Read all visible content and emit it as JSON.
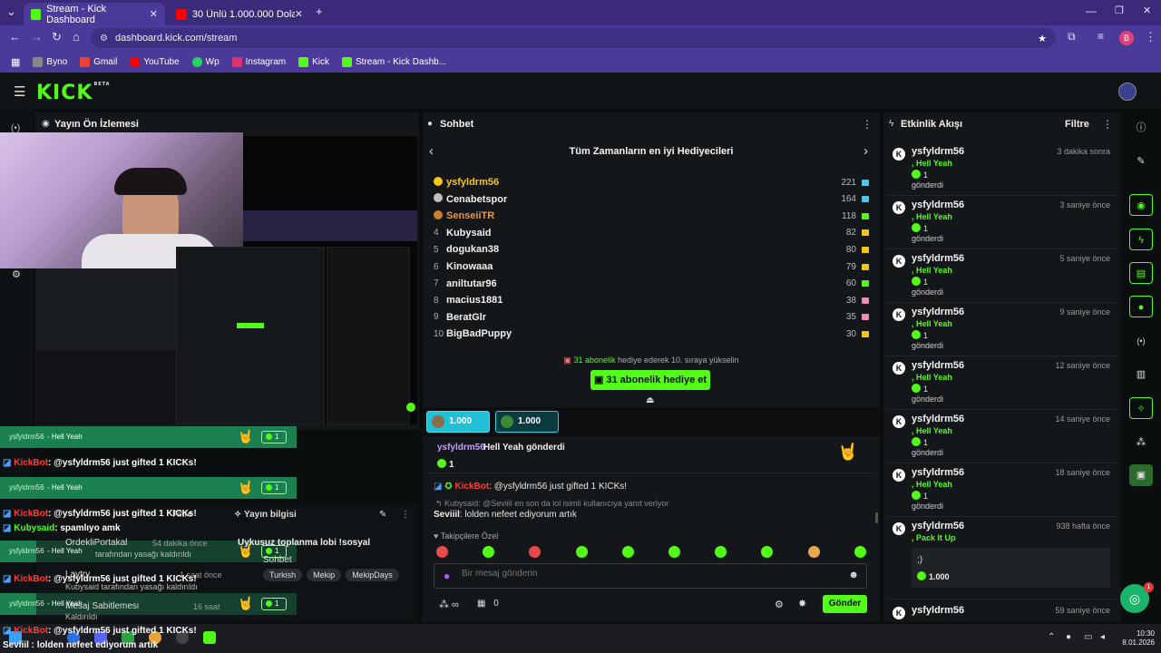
{
  "browser": {
    "tabs": [
      {
        "label": "Stream - Kick Dashboard",
        "active": true,
        "fav_color": "#53fc18"
      },
      {
        "label": "30 Ünlü 1.000.000 Dolar için Ya...",
        "active": false,
        "fav_color": "#ff0000"
      }
    ],
    "new_tab": "+",
    "url": "dashboard.kick.com/stream",
    "profile_initial": "B",
    "bookmarks": [
      {
        "label": "Byno",
        "color": "#888"
      },
      {
        "label": "Gmail",
        "color": "#ea4335"
      },
      {
        "label": "YouTube",
        "color": "#ff0000"
      },
      {
        "label": "Wp",
        "color": "#25d366"
      },
      {
        "label": "Instagram",
        "color": "#e1306c"
      },
      {
        "label": "Kick",
        "color": "#53fc18"
      },
      {
        "label": "Stream - Kick Dashb...",
        "color": "#53fc18"
      }
    ]
  },
  "app": {
    "logo": "KICK",
    "beta": "BETA"
  },
  "preview": {
    "title": "Yayın Ön İzlemesi"
  },
  "chat": {
    "title": "Sohbet",
    "leaderboard_title": "Tüm Zamanların en iyi Hediyecileri",
    "leaders": [
      {
        "rank": "1",
        "name": "ysfyldrm56",
        "count": "221",
        "color": "#f5c518"
      },
      {
        "rank": "2",
        "name": "Cenabetspor",
        "count": "164",
        "color": "#c0c0c0"
      },
      {
        "rank": "3",
        "name": "SenseiiTR",
        "count": "118",
        "color": "#cd7f32"
      },
      {
        "rank": "4",
        "name": "Kubysaid",
        "count": "82",
        "color": ""
      },
      {
        "rank": "5",
        "name": "dogukan38",
        "count": "80",
        "color": ""
      },
      {
        "rank": "6",
        "name": "Kinowaaa",
        "count": "79",
        "color": ""
      },
      {
        "rank": "7",
        "name": "aniltutar96",
        "count": "60",
        "color": ""
      },
      {
        "rank": "8",
        "name": "macius1881",
        "count": "38",
        "color": ""
      },
      {
        "rank": "9",
        "name": "BeratGlr",
        "count": "35",
        "color": ""
      },
      {
        "rank": "10",
        "name": "BigBadPuppy",
        "count": "30",
        "color": ""
      }
    ],
    "rank_up_count": "31 abonelik",
    "rank_up_text": "hediye ederek 10. sıraya yükselin",
    "gift_button": "31 abonelik hediye et",
    "goal1": "1.000",
    "goal2": "1.000",
    "pinned_user": "ysfyldrm56",
    "pinned_text": "Hell Yeah gönderdi",
    "pinned_amount": "1",
    "bot_name": "KickBot",
    "bot_msg": ": @ysfyldrm56 just gifted 1 KICKs!",
    "reply_line": "Kubysaid: @Seviiil en son da lol isimli kullanıcıya yanıt veriyor",
    "seviiil_name": "Seviiil",
    "seviiil_msg": ": lolden nefeet ediyorum artık",
    "emote_header": "Takipçilere Özel",
    "input_placeholder": "Bir mesaj gönderin",
    "infinity_count": "0",
    "send_button": "Gönder"
  },
  "activity": {
    "title": "Etkinlik Akışı",
    "filter": "Filtre",
    "items": [
      {
        "user": "ysfyldrm56",
        "when": "3 dakika sonra",
        "msg": ", Hell Yeah",
        "amount": "1",
        "sent": "gönderdi"
      },
      {
        "user": "ysfyldrm56",
        "when": "3 saniye önce",
        "msg": ", Hell Yeah",
        "amount": "1",
        "sent": "gönderdi"
      },
      {
        "user": "ysfyldrm56",
        "when": "5 saniye önce",
        "msg": ", Hell Yeah",
        "amount": "1",
        "sent": "gönderdi"
      },
      {
        "user": "ysfyldrm56",
        "when": "9 saniye önce",
        "msg": ", Hell Yeah",
        "amount": "1",
        "sent": "gönderdi"
      },
      {
        "user": "ysfyldrm56",
        "when": "12 saniye önce",
        "msg": ", Hell Yeah",
        "amount": "1",
        "sent": "gönderdi"
      },
      {
        "user": "ysfyldrm56",
        "when": "14 saniye önce",
        "msg": ", Hell Yeah",
        "amount": "1",
        "sent": "gönderdi"
      },
      {
        "user": "ysfyldrm56",
        "when": "18 saniye önce",
        "msg": ", Hell Yeah",
        "amount": "1",
        "sent": "gönderdi"
      }
    ],
    "big_item": {
      "user": "ysfyldrm56",
      "when": "938 hafta önce",
      "msg": ", Pack It Up",
      "note": ";)",
      "amount": "1.000"
    },
    "last_item": {
      "user": "ysfyldrm56",
      "when": "59 saniye önce"
    }
  },
  "overlay": {
    "hell_yeah": "- Hell Yeah",
    "user": "ysfyldrm56",
    "gift_count": "1",
    "bot": "KickBot",
    "bot_msg": ": @ysfyldrm56 just gifted 1 KICKs!",
    "kubysaid": "Kubysaid",
    "kubysaid_msg": ": spamlıyo amk",
    "filtre": "Filtre",
    "yayin_bilgisi": "Yayın bilgisi",
    "ordekli": "OrdekliPortakal",
    "ordekli_time": "54 dakika önce",
    "ban_removed": "tarafından yasağı kaldırıldı",
    "title_text": "Uykusuz toplanma lobi !sosyal",
    "sohbet": "Sohbet",
    "tags": [
      "Turkish",
      "Mekip",
      "MekipDays"
    ],
    "laytry": "Laytry",
    "laytry_time": "1 saat önce",
    "kubysaid_ban": "Kubysaid tarafından yasağı kaldırıldı",
    "pin_msg": "Mesaj Sabitlemesi",
    "pin_time": "16 saat",
    "pin_removed": "Kaldırıldı",
    "seviiil_line": "Seviiil : lolden nefeet ediyorum artık"
  },
  "taskbar": {
    "time": "10:30",
    "date": "8.01.2026"
  },
  "colors": {
    "accent": "#53fc18",
    "browser": "#4c3a9a",
    "bg": "#0b0e0f"
  }
}
